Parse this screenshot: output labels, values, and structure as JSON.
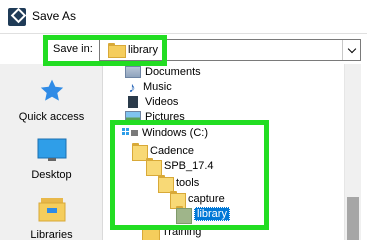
{
  "window": {
    "title": "Save As"
  },
  "save_in": {
    "label": "Save in:",
    "value": "library"
  },
  "places": [
    {
      "label": "Quick access",
      "icon": "star-icon"
    },
    {
      "label": "Desktop",
      "icon": "desktop-icon"
    },
    {
      "label": "Libraries",
      "icon": "libraries-icon"
    }
  ],
  "tree": {
    "documents": "Documents",
    "music": "Music",
    "videos": "Videos",
    "pictures": "Pictures",
    "drive": "Windows (C:)",
    "cadence": "Cadence",
    "spb": "SPB_17.4",
    "tools": "tools",
    "capture": "capture",
    "library": "library",
    "training": "Training"
  },
  "colors": {
    "highlight": "#22dd22",
    "selection": "#0078d7"
  }
}
